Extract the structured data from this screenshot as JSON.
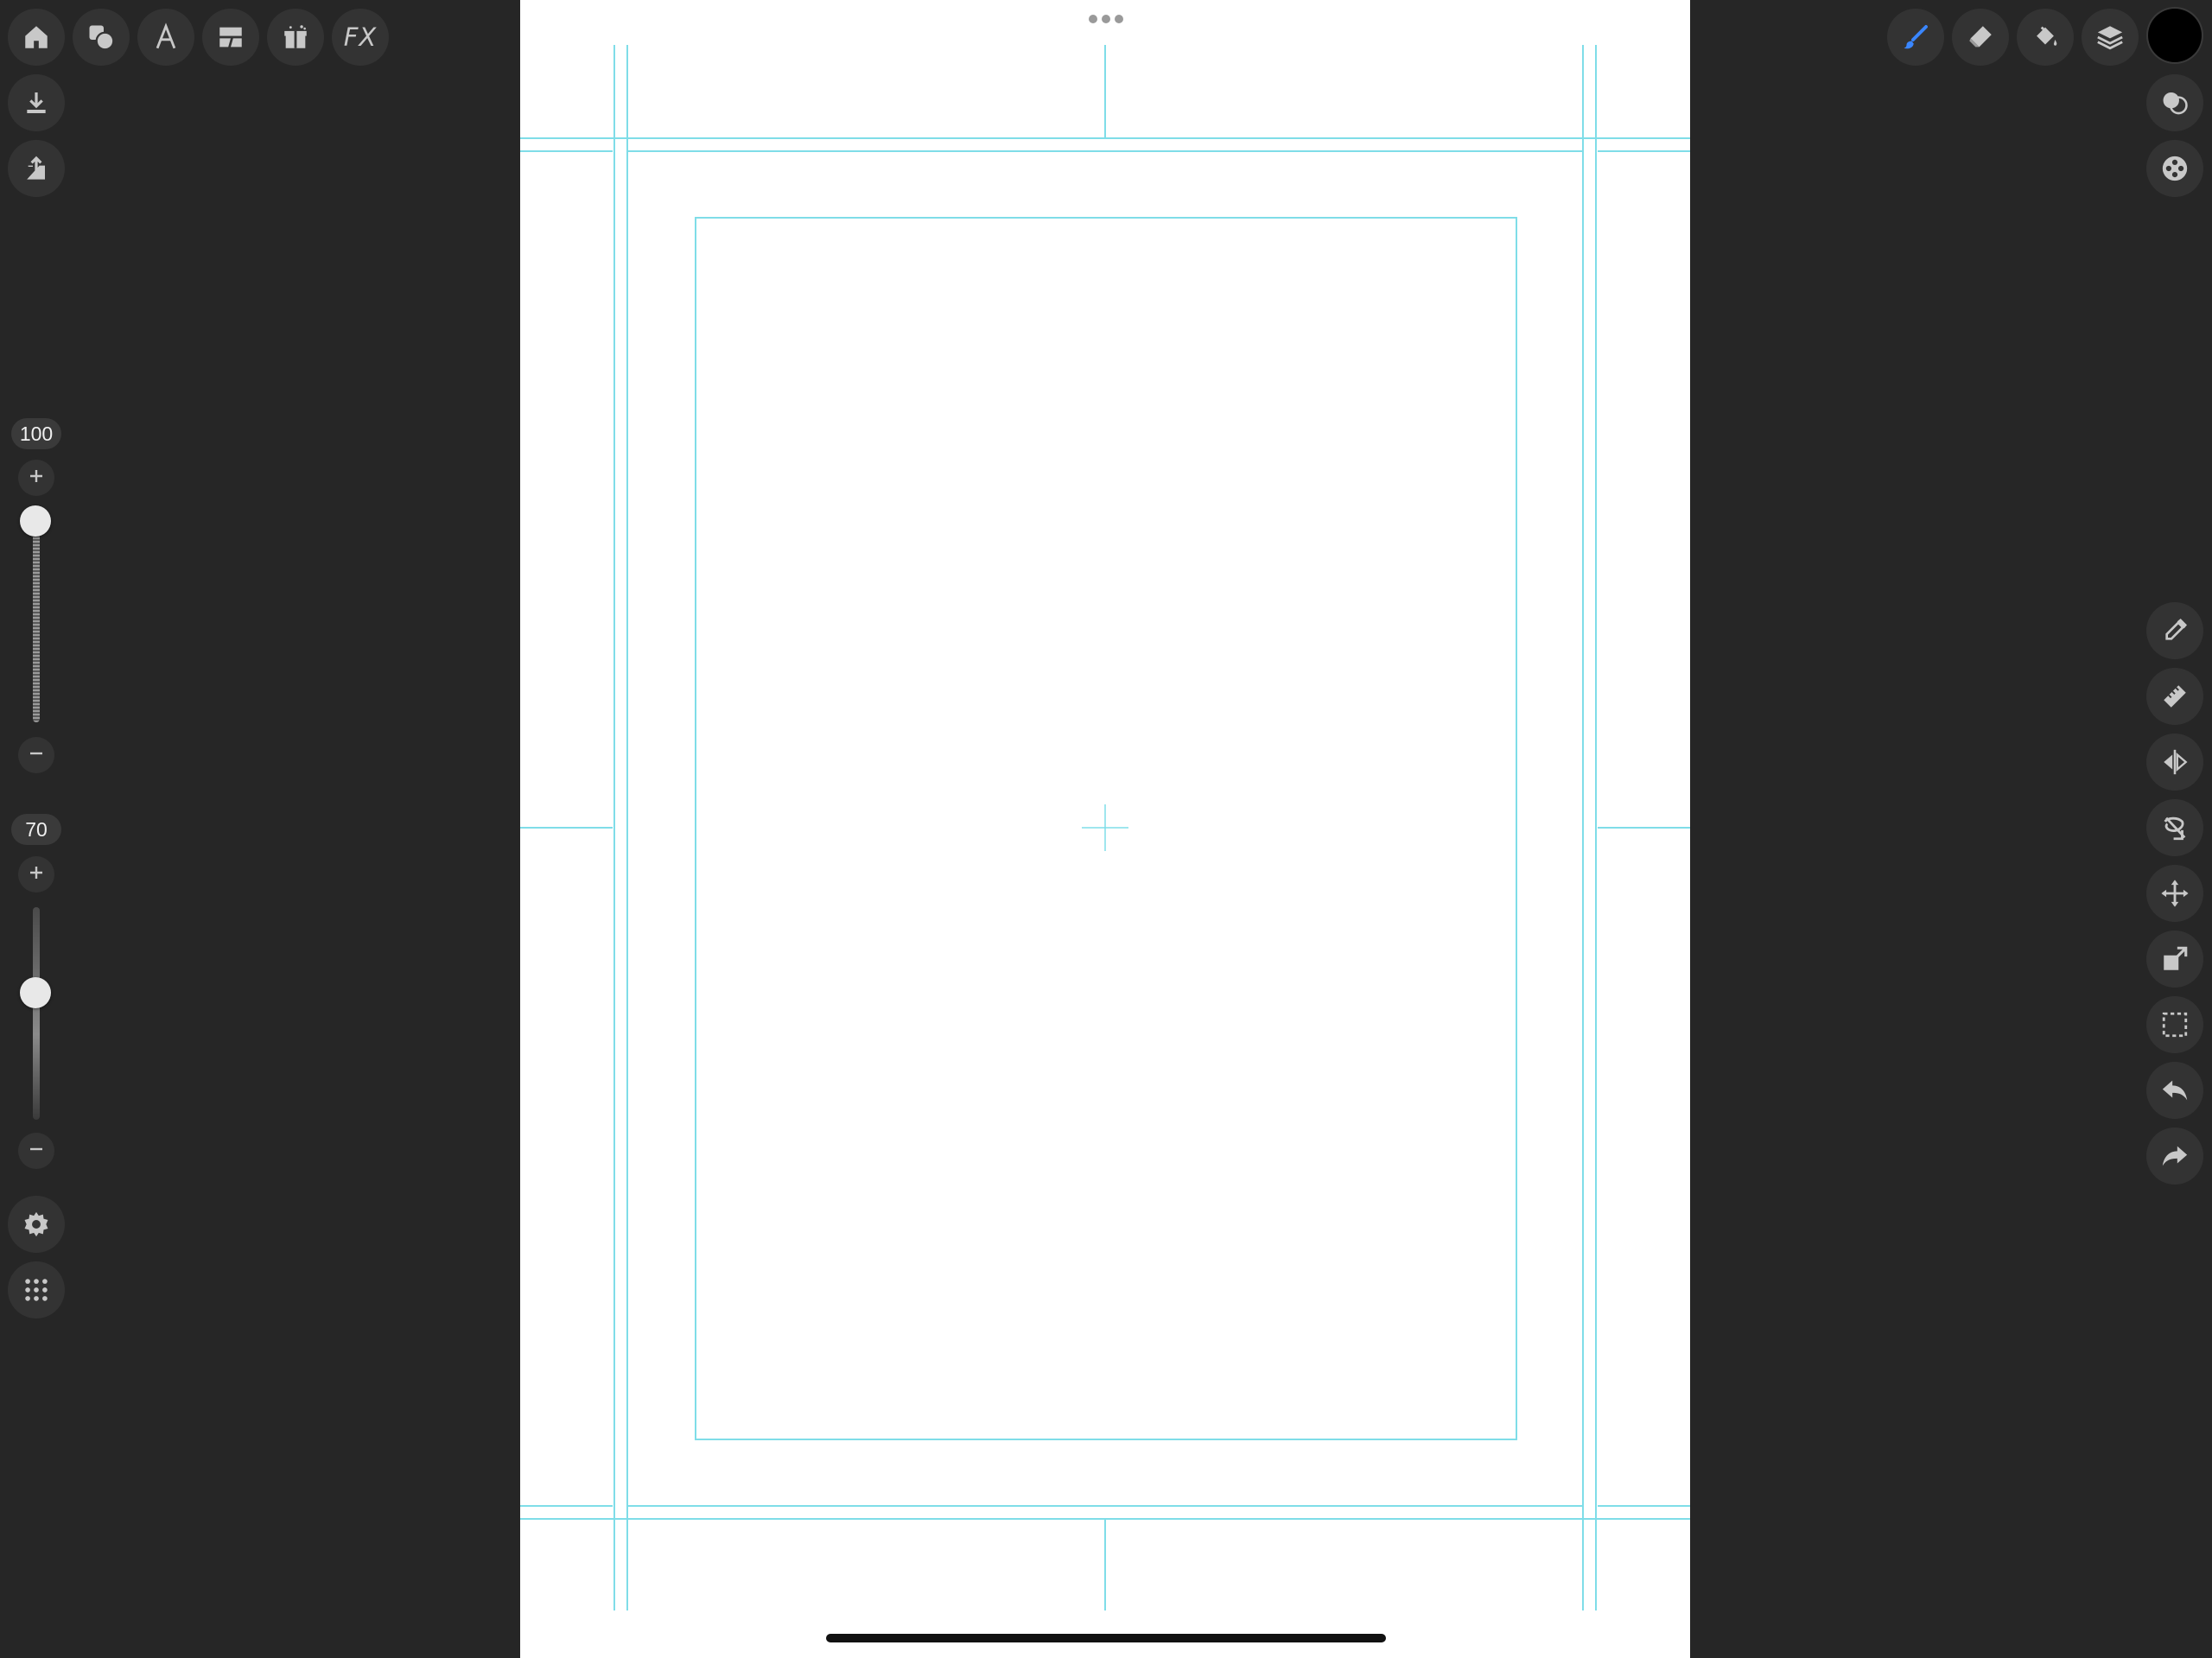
{
  "toolbar_top_left": {
    "fx_label": "FX"
  },
  "brush_size": {
    "value": "100",
    "level_percent": 100
  },
  "brush_opacity": {
    "value": "70",
    "level_percent": 70
  },
  "colors": {
    "background": "#262626",
    "button": "#333333",
    "icon": "#c8c8c8",
    "active_brush": "#3a86ff",
    "canvas": "#ffffff",
    "guide": "#7fdde8",
    "current_color": "#000000"
  },
  "icons": {
    "top_left": [
      "home-icon",
      "shapes-icon",
      "text-icon",
      "panel-layout-icon",
      "gift-icon",
      "fx-icon"
    ],
    "left_column": [
      "download-icon",
      "share-icon",
      "settings-icon",
      "grid-menu-icon"
    ],
    "top_right": [
      "brush-icon",
      "eraser-icon",
      "fill-bucket-icon",
      "layers-icon"
    ],
    "right_column_top": [
      "blend-icon",
      "palette-icon"
    ],
    "right_column_bottom": [
      "eyedropper-icon",
      "ruler-icon",
      "symmetry-icon",
      "lasso-fill-icon",
      "move-icon",
      "transform-icon",
      "selection-icon",
      "undo-icon",
      "redo-icon"
    ]
  }
}
